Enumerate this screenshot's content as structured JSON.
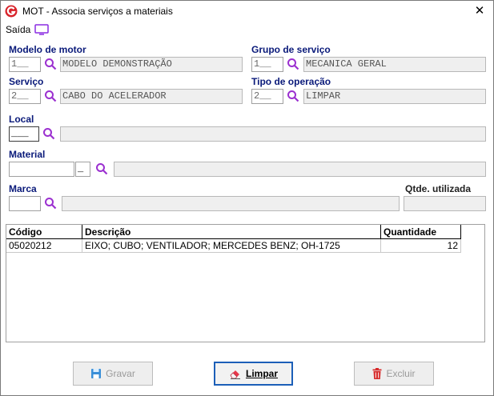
{
  "window": {
    "title": "MOT - Associa serviços a materiais",
    "close_glyph": "✕"
  },
  "menu": {
    "saida": "Saída",
    "monitor_icon": "monitor-icon"
  },
  "form": {
    "modelo_label": "Modelo de motor",
    "modelo_code": "1__",
    "modelo_desc": "MODELO DEMONSTRAÇÃO",
    "grupo_label": "Grupo de serviço",
    "grupo_code": "1__",
    "grupo_desc": "MECANICA GERAL",
    "servico_label": "Serviço",
    "servico_code": "2__",
    "servico_desc": "CABO DO ACELERADOR",
    "tipo_label": "Tipo de operação",
    "tipo_code": "2__",
    "tipo_desc": "LIMPAR",
    "local_label": "Local",
    "local_code": "___",
    "local_desc": "",
    "material_label": "Material",
    "material_code": "",
    "material_suffix": "_",
    "material_desc": "",
    "marca_label": "Marca",
    "marca_code": "",
    "marca_desc": "",
    "qtde_label": "Qtde. utilizada",
    "qtde_value": ""
  },
  "grid": {
    "columns": [
      "Código",
      "Descrição",
      "Quantidade"
    ],
    "rows": [
      [
        "05020212",
        "EIXO; CUBO; VENTILADOR; MERCEDES BENZ; OH-1725",
        "12"
      ]
    ]
  },
  "buttons": {
    "gravar": "Gravar",
    "limpar": "Limpar",
    "excluir": "Excluir"
  },
  "colors": {
    "label_blue": "#0a1a7a",
    "search_purple": "#9b30d0",
    "focus_blue": "#1c5fb8"
  }
}
